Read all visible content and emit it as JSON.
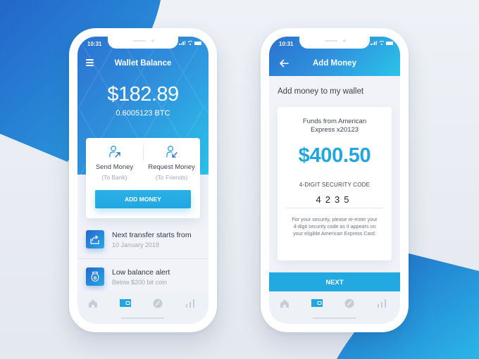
{
  "colors": {
    "brand_blue": "#2a72d0",
    "brand_cyan": "#2bc4ea",
    "accent": "#22a6e0",
    "background": "#eaeef4",
    "tab_inactive": "#c7ccd5"
  },
  "wallet_screen": {
    "status_bar": {
      "time": "10:31"
    },
    "header": {
      "title": "Wallet Balance",
      "menu_icon": "hamburger-menu-icon"
    },
    "balance": {
      "amount": "$182.89",
      "btc": "0.6005123 BTC"
    },
    "actions": [
      {
        "label": "Send Money",
        "sublabel": "(To Bank)",
        "icon": "send-money-icon"
      },
      {
        "label": "Request Money",
        "sublabel": "(To Friends)",
        "icon": "request-money-icon"
      }
    ],
    "add_money_button": "ADD MONEY",
    "list": [
      {
        "title": "Next transfer starts from",
        "subtitle": "10 January 2018",
        "icon": "transfer-icon"
      },
      {
        "title": "Low balance alert",
        "subtitle": "Below $200 bit coin",
        "icon": "bitcoin-bag-icon"
      }
    ],
    "tabs": [
      {
        "name": "home",
        "icon": "home-icon",
        "active": false
      },
      {
        "name": "wallet",
        "icon": "wallet-icon",
        "active": true
      },
      {
        "name": "explore",
        "icon": "compass-icon",
        "active": false
      },
      {
        "name": "stats",
        "icon": "bar-chart-icon",
        "active": false
      }
    ]
  },
  "add_money_screen": {
    "status_bar": {
      "time": "10:31"
    },
    "header": {
      "title": "Add Money",
      "back_icon": "back-arrow-icon"
    },
    "subtitle": "Add money to my wallet",
    "card": {
      "funds_from": "Funds from American Express x20123",
      "amount": "$400.50",
      "security_label": "4-DIGIT SECURITY CODE",
      "security_code": "4235",
      "note": "For your security, please re-enter your 4-digit security code as it appears on your eligible American Express Card."
    },
    "next_button": "NEXT",
    "tabs": [
      {
        "name": "home",
        "icon": "home-icon",
        "active": false
      },
      {
        "name": "wallet",
        "icon": "wallet-icon",
        "active": true
      },
      {
        "name": "explore",
        "icon": "compass-icon",
        "active": false
      },
      {
        "name": "stats",
        "icon": "bar-chart-icon",
        "active": false
      }
    ]
  }
}
